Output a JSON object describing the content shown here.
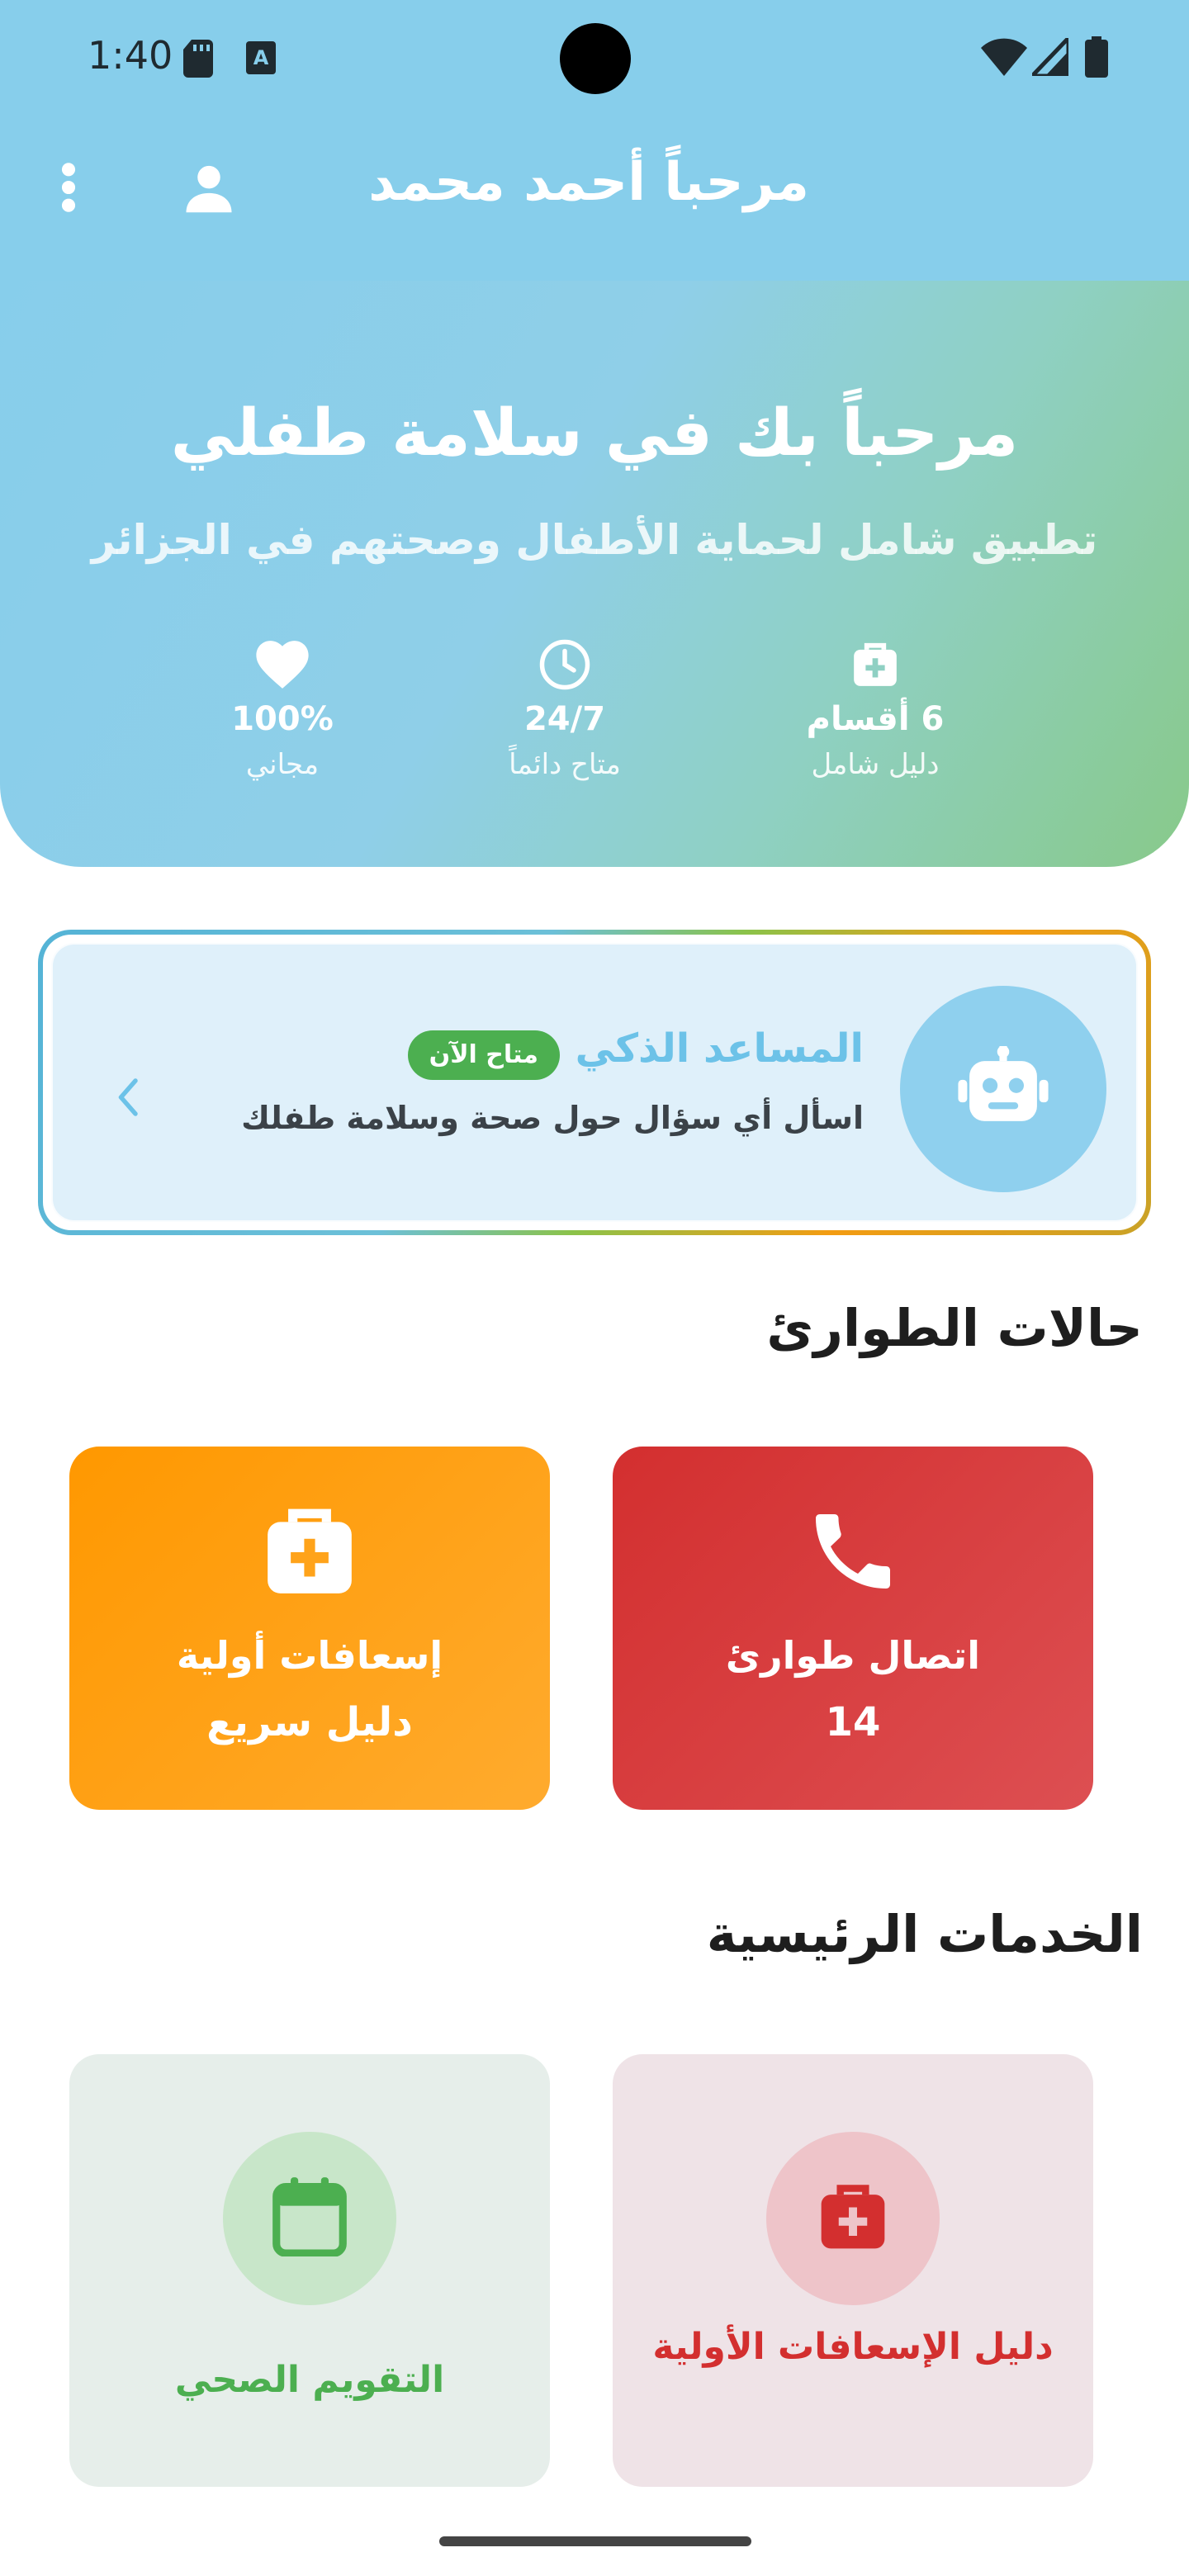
{
  "status_bar": {
    "time": "1:40",
    "icons": [
      "sd-card-icon",
      "keyboard-a-icon",
      "wifi-icon",
      "signal-icon",
      "battery-icon"
    ]
  },
  "app_bar": {
    "title": "مرحباً أحمد محمد",
    "profile_icon": "person-icon",
    "menu_icon": "more-vert-icon",
    "background_color": "#87ceeb"
  },
  "hero": {
    "title": "مرحباً بك في سلامة طفلي",
    "subtitle": "تطبيق شامل لحماية الأطفال وصحتهم في الجزائر",
    "stats": [
      {
        "icon": "medical-kit-icon",
        "value": "6 أقسام",
        "label": "دليل شامل"
      },
      {
        "icon": "clock-icon",
        "value": "24/7",
        "label": "متاح دائماً"
      },
      {
        "icon": "heart-icon",
        "value": "100%",
        "label": "مجاني"
      }
    ]
  },
  "ai_assistant": {
    "title": "المساعد الذكي",
    "badge": "متاح الآن",
    "description": "اسأل أي سؤال حول صحة وسلامة طفلك",
    "avatar_icon": "robot-icon",
    "chevron_icon": "chevron-left-icon"
  },
  "emergency": {
    "section_title": "حالات الطوارئ",
    "cards": [
      {
        "icon": "phone-icon",
        "line1": "اتصال طوارئ",
        "line2": "14",
        "color": "#d32f2f"
      },
      {
        "icon": "medical-kit-icon",
        "line1": "إسعافات أولية",
        "line2": "دليل سريع",
        "color": "#ff9800"
      }
    ]
  },
  "services": {
    "section_title": "الخدمات الرئيسية",
    "cards": [
      {
        "icon": "medical-kit-icon",
        "label": "دليل الإسعافات الأولية",
        "color": "#d32f2f"
      },
      {
        "icon": "calendar-icon",
        "label": "التقويم الصحي",
        "color": "#4caf50"
      }
    ]
  }
}
